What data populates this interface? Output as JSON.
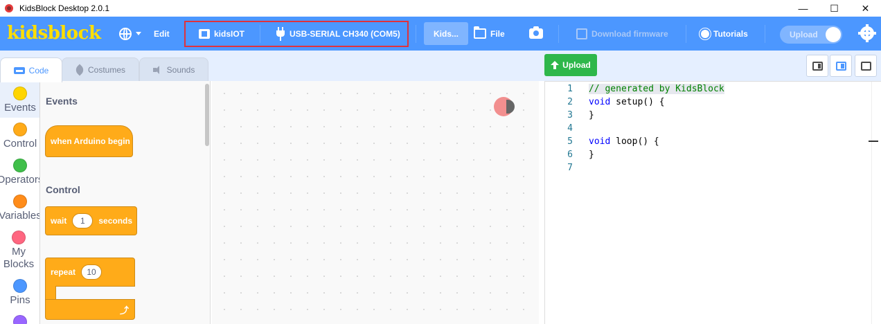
{
  "window": {
    "title": "KidsBlock Desktop 2.0.1",
    "controls": [
      "—",
      "☐",
      "✕"
    ]
  },
  "menubar": {
    "logo": "kidsblock",
    "edit": "Edit",
    "device": "kidsIOT",
    "port": "USB-SERIAL CH340 (COM5)",
    "project_tab": "Kids...",
    "file": "File",
    "download_firmware": "Download firmware",
    "tutorials": "Tutorials",
    "upload_toggle": "Upload"
  },
  "tabs": [
    {
      "label": "Code",
      "active": true
    },
    {
      "label": "Costumes",
      "active": false
    },
    {
      "label": "Sounds",
      "active": false
    }
  ],
  "categories": [
    {
      "label": "Events",
      "color": "#ffd500"
    },
    {
      "label": "Control",
      "color": "#ffab19"
    },
    {
      "label": "Operators",
      "color": "#40bf4a"
    },
    {
      "label": "Variables",
      "color": "#ff8c1a"
    },
    {
      "label": "My Blocks",
      "color": "#ff6680"
    },
    {
      "label": "Pins",
      "color": "#4c97ff"
    }
  ],
  "palette": {
    "events_title": "Events",
    "when_begin": "when Arduino begin",
    "control_title": "Control",
    "wait_label": "wait",
    "wait_value": "1",
    "wait_unit": "seconds",
    "repeat_label": "repeat",
    "repeat_value": "10"
  },
  "code_panel": {
    "upload_button": "Upload",
    "line_numbers": [
      "1",
      "2",
      "3",
      "4",
      "5",
      "6",
      "7"
    ],
    "lines": [
      "// generated by KidsBlock",
      "void setup() {",
      "}",
      "",
      "void loop() {",
      "}",
      ""
    ]
  },
  "colors": {
    "menubar": "#4c97ff",
    "logo": "#ffde00",
    "block_control": "#ffab19",
    "upload_green": "#2eb74a",
    "highlight_red": "#e0313b"
  }
}
